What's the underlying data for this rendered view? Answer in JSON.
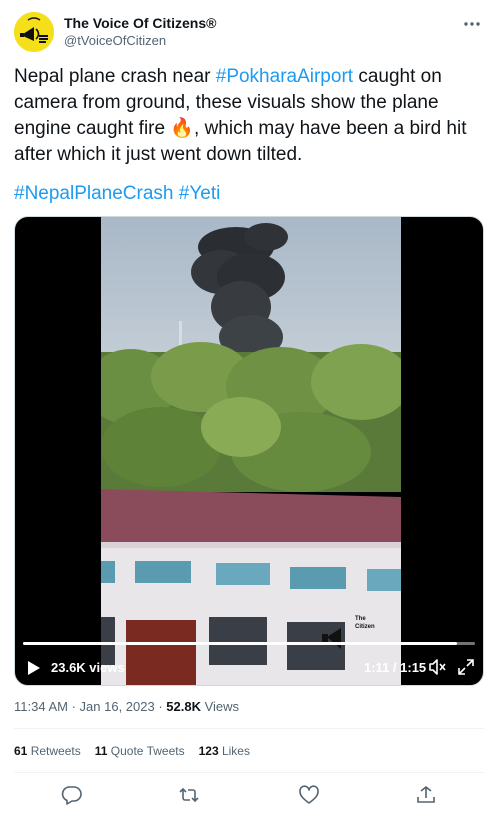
{
  "account": {
    "name": "The Voice Of Citizens®",
    "handle": "@tVoiceOfCitizen"
  },
  "tweet": {
    "text_part1": "Nepal plane crash near ",
    "hashtag_airport": "#PokharaAirport",
    "text_part2": " caught on camera from ground, these visuals show the plane engine caught fire ",
    "emoji": "🔥",
    "text_part3": ", which may have been a bird hit after which it just went down tilted.",
    "hashtag_crash": "#NepalPlaneCrash",
    "hashtag_yeti": "#Yeti"
  },
  "video": {
    "views": "23.6K views",
    "time": "1:11 / 1:15",
    "progress": 0.96,
    "watermark": "The Citizens"
  },
  "meta": {
    "time": "11:34 AM",
    "sep1": " · ",
    "date": "Jan 16, 2023",
    "sep2": " · ",
    "view_count": "52.8K",
    "views_label": " Views"
  },
  "stats": {
    "retweets_count": "61",
    "retweets_label": "Retweets",
    "quotes_count": "11",
    "quotes_label": "Quote Tweets",
    "likes_count": "123",
    "likes_label": "Likes"
  },
  "icons": {
    "more": "more-icon",
    "reply": "reply-icon",
    "retweet": "retweet-icon",
    "like": "like-icon",
    "share": "share-icon"
  },
  "colors": {
    "link": "#1d9bf0",
    "muted": "#536471",
    "text": "#0f1419",
    "avatar": "#f4df1a"
  }
}
